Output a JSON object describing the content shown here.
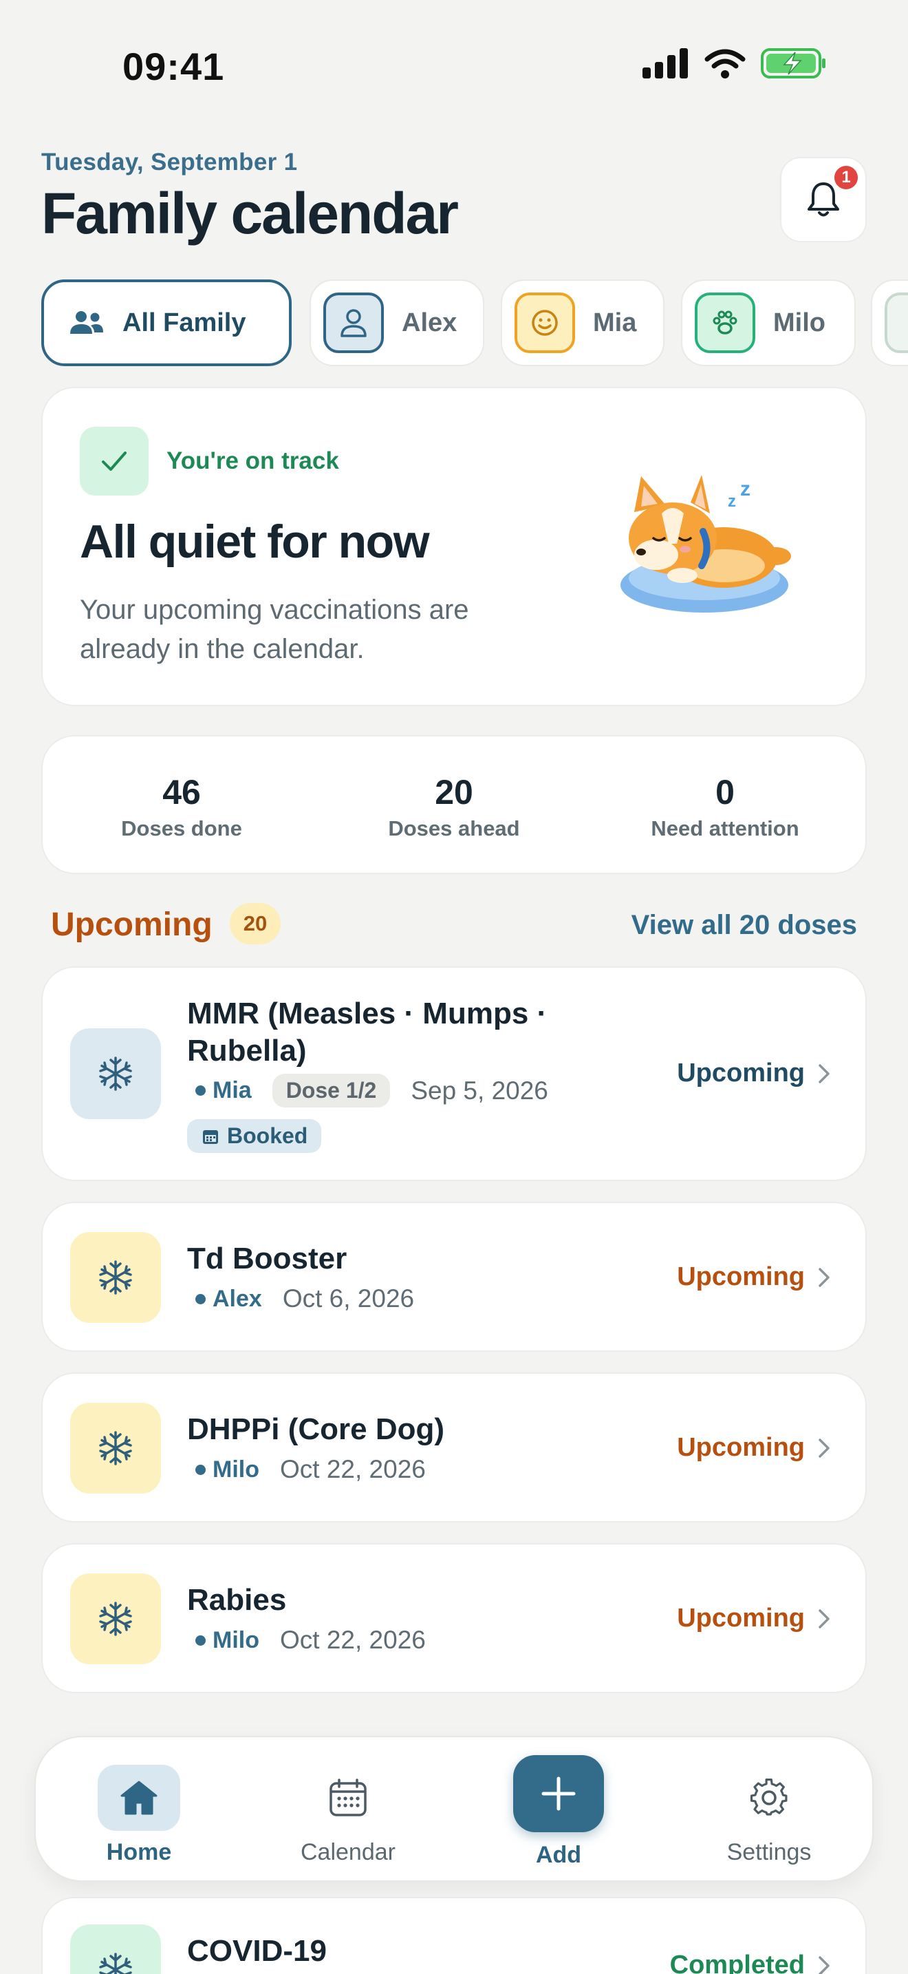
{
  "status_bar": {
    "time": "09:41"
  },
  "header": {
    "date": "Tuesday, September 1",
    "title": "Family calendar",
    "notification_count": "1"
  },
  "filters": [
    {
      "label": "All Family",
      "icon": "people-icon",
      "active": true
    },
    {
      "label": "Alex",
      "icon": "person-icon",
      "color": "#2f6685"
    },
    {
      "label": "Mia",
      "icon": "smiley-icon",
      "color": "#f0a323"
    },
    {
      "label": "Milo",
      "icon": "paw-icon",
      "color": "#27b07a"
    }
  ],
  "status_card": {
    "badge": "You're on track",
    "title": "All quiet for now",
    "description": "Your upcoming vaccinations are already in the calendar.",
    "illustration": "sleeping-corgi"
  },
  "stats": [
    {
      "value": "46",
      "label": "Doses done"
    },
    {
      "value": "20",
      "label": "Doses ahead"
    },
    {
      "value": "0",
      "label": "Need attention"
    }
  ],
  "upcoming": {
    "title": "Upcoming",
    "count": "20",
    "view_all": "View all 20 doses",
    "items": [
      {
        "name_line1": "MMR (Measles · Mumps ·",
        "name_line2": "Rubella)",
        "person": "Mia",
        "dose": "Dose 1/2",
        "date": "Sep 5, 2026",
        "tag": "Booked",
        "status": "Upcoming",
        "status_color": "#1f4b63",
        "icon_bg": "#dde9f1"
      },
      {
        "name": "Td Booster",
        "person": "Alex",
        "date": "Oct 6, 2026",
        "status": "Upcoming",
        "status_color": "#b7500e",
        "icon_bg": "#fdf1bf"
      },
      {
        "name": "DHPPi (Core Dog)",
        "person": "Milo",
        "date": "Oct 22, 2026",
        "status": "Upcoming",
        "status_color": "#b7500e",
        "icon_bg": "#fdf1bf"
      },
      {
        "name": "Rabies",
        "person": "Milo",
        "date": "Oct 22, 2026",
        "status": "Upcoming",
        "status_color": "#b7500e",
        "icon_bg": "#fdf1bf"
      },
      {
        "name": "COVID-19",
        "status": "Completed",
        "status_color": "#1d8a55",
        "icon_bg": "#d6f4e2"
      }
    ]
  },
  "nav": {
    "home": "Home",
    "calendar": "Calendar",
    "add": "Add",
    "settings": "Settings"
  }
}
